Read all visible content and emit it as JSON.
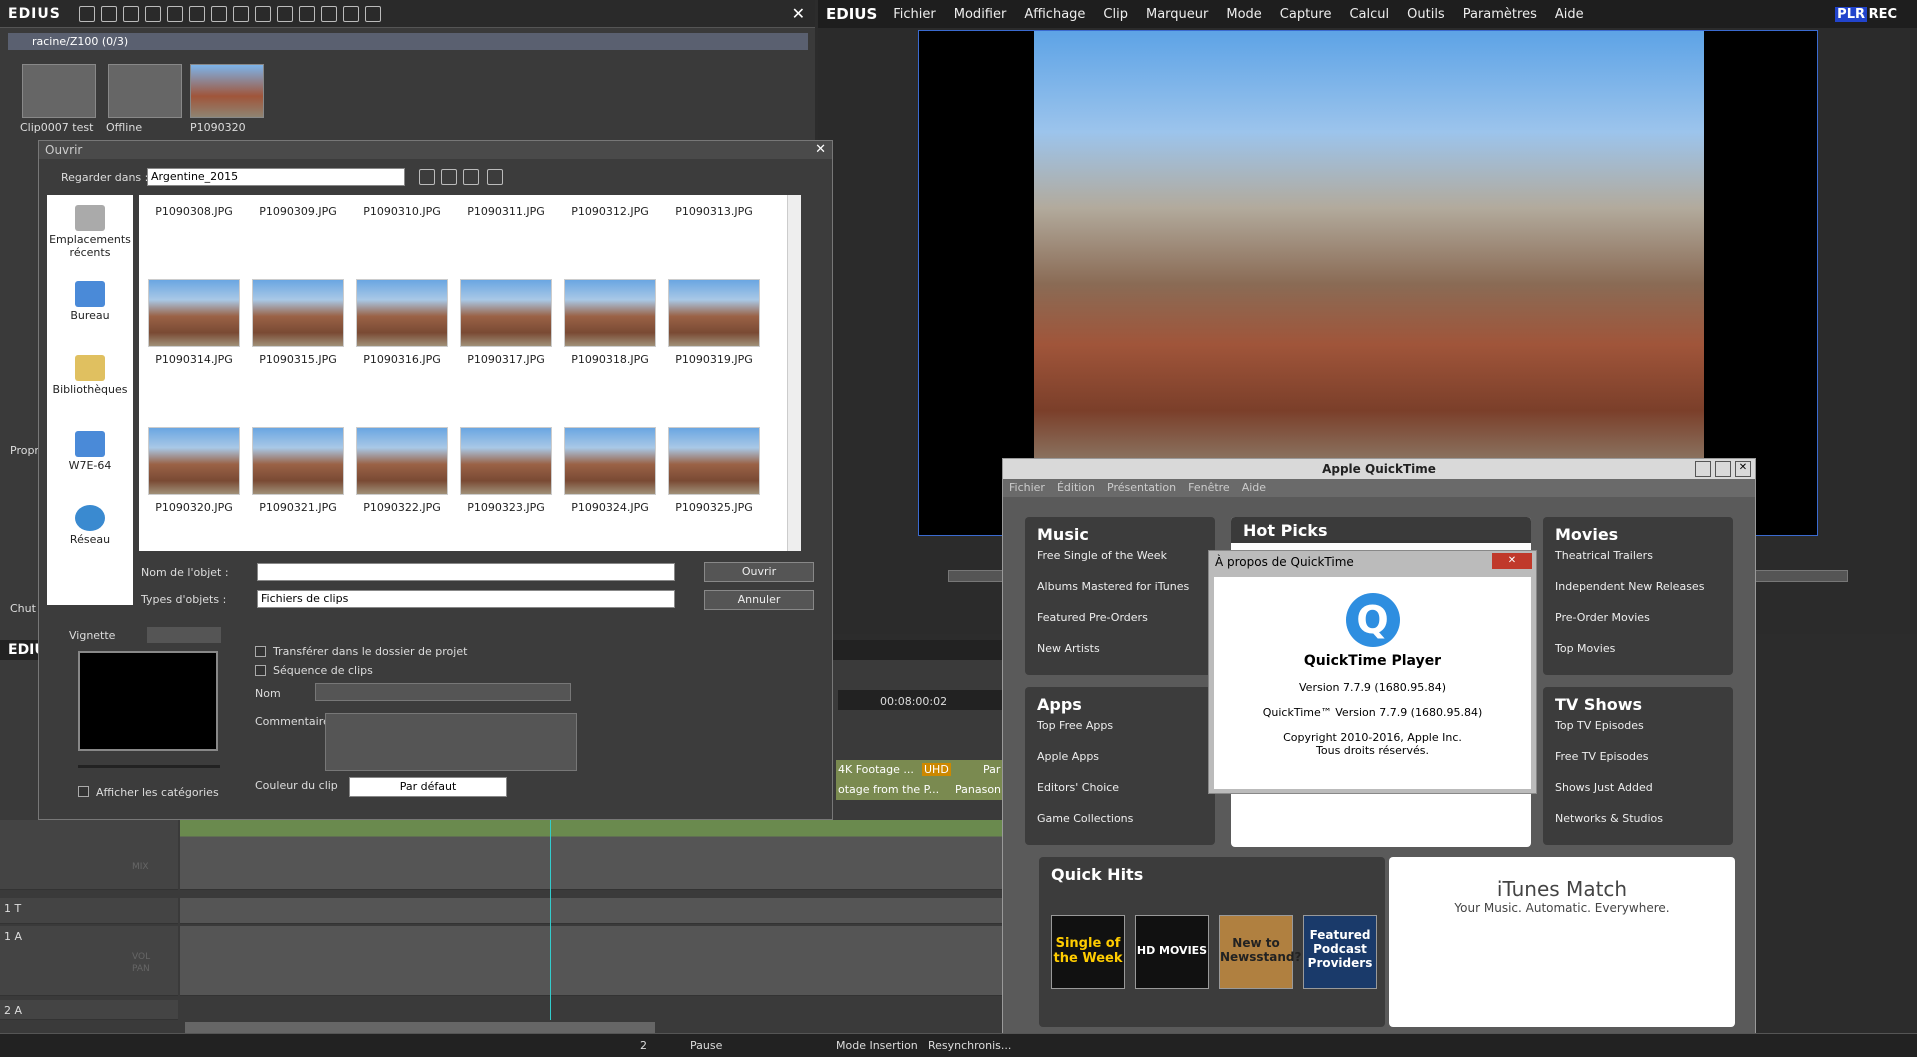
{
  "bin": {
    "app_logo": "EDIUS",
    "path": "racine/Z100 (0/3)",
    "clips": [
      "Clip0007 test",
      "Offline",
      "P1090320"
    ],
    "side_label_1": "Propri",
    "side_label_2": "Chut",
    "tl_logo": "EDIU"
  },
  "preview": {
    "app_logo": "EDIUS",
    "menu": [
      "Fichier",
      "Modifier",
      "Affichage",
      "Clip",
      "Marqueur",
      "Mode",
      "Capture",
      "Calcul",
      "Outils",
      "Paramètres",
      "Aide"
    ],
    "badge_plr": "PLR",
    "badge_rec": "REC"
  },
  "dialog": {
    "title": "Ouvrir",
    "look_in_label": "Regarder dans :",
    "look_in_value": "Argentine_2015",
    "places": [
      "Emplacements récents",
      "Bureau",
      "Bibliothèques",
      "W7E-64",
      "Réseau"
    ],
    "row0": [
      "P1090308.JPG",
      "P1090309.JPG",
      "P1090310.JPG",
      "P1090311.JPG",
      "P1090312.JPG",
      "P1090313.JPG"
    ],
    "row1": [
      "P1090314.JPG",
      "P1090315.JPG",
      "P1090316.JPG",
      "P1090317.JPG",
      "P1090318.JPG",
      "P1090319.JPG"
    ],
    "row2": [
      "P1090320.JPG",
      "P1090321.JPG",
      "P1090322.JPG",
      "P1090323.JPG",
      "P1090324.JPG",
      "P1090325.JPG"
    ],
    "name_label": "Nom de l'objet :",
    "type_label": "Types d'objets :",
    "type_value": "Fichiers de clips",
    "open_button": "Ouvrir",
    "cancel_button": "Annuler",
    "thumb_label": "Vignette",
    "opt_transfer": "Transférer dans le dossier de projet",
    "opt_sequence": "Séquence de clips",
    "field_name": "Nom",
    "field_comment": "Commentaire",
    "clip_color_label": "Couleur du clip",
    "clip_color_value": "Par défaut",
    "show_categories": "Afficher les catégories"
  },
  "timeline": {
    "timecode": "00:08:00:02",
    "clip1": "4K Footage ...",
    "clip1_badge": "UHD",
    "clip2": "Par",
    "clip3": "otage from the P...",
    "clip4": "Panasoni",
    "track_t": "1 T",
    "track_a1": "1 A",
    "track_a2": "2 A",
    "mix": "MIX",
    "vol": "VOL",
    "pan": "PAN"
  },
  "quicktime": {
    "title": "Apple QuickTime",
    "menu": [
      "Fichier",
      "Édition",
      "Présentation",
      "Fenêtre",
      "Aide"
    ],
    "music": {
      "title": "Music",
      "items": [
        "Free Single of the Week",
        "Albums Mastered for iTunes",
        "Featured Pre-Orders",
        "New Artists"
      ]
    },
    "hot": {
      "title": "Hot Picks"
    },
    "movies": {
      "title": "Movies",
      "items": [
        "Theatrical Trailers",
        "Independent New Releases",
        "Pre-Order Movies",
        "Top Movies"
      ]
    },
    "apps": {
      "title": "Apps",
      "items": [
        "Top Free Apps",
        "Apple Apps",
        "Editors' Choice",
        "Game Collections"
      ]
    },
    "tv": {
      "title": "TV Shows",
      "items": [
        "Top TV Episodes",
        "Free TV Episodes",
        "Shows Just Added",
        "Networks & Studios"
      ]
    },
    "quickhits": {
      "title": "Quick Hits",
      "tiles": [
        "Single of the Week",
        "HD MOVIES",
        "New to Newsstand?",
        "Featured Podcast Providers"
      ]
    },
    "itunes_match": {
      "title": "iTunes Match",
      "subtitle": "Your Music. Automatic. Everywhere."
    }
  },
  "about": {
    "title": "À propos de QuickTime",
    "app": "QuickTime Player",
    "version": "Version 7.7.9 (1680.95.84)",
    "qt_version": "QuickTime™ Version 7.7.9 (1680.95.84)",
    "copyright": "Copyright 2010-2016, Apple Inc.",
    "rights": "Tous droits réservés."
  },
  "status": {
    "count": "2",
    "state": "Pause",
    "mode": "Mode Insertion",
    "sync": "Resynchronis..."
  }
}
